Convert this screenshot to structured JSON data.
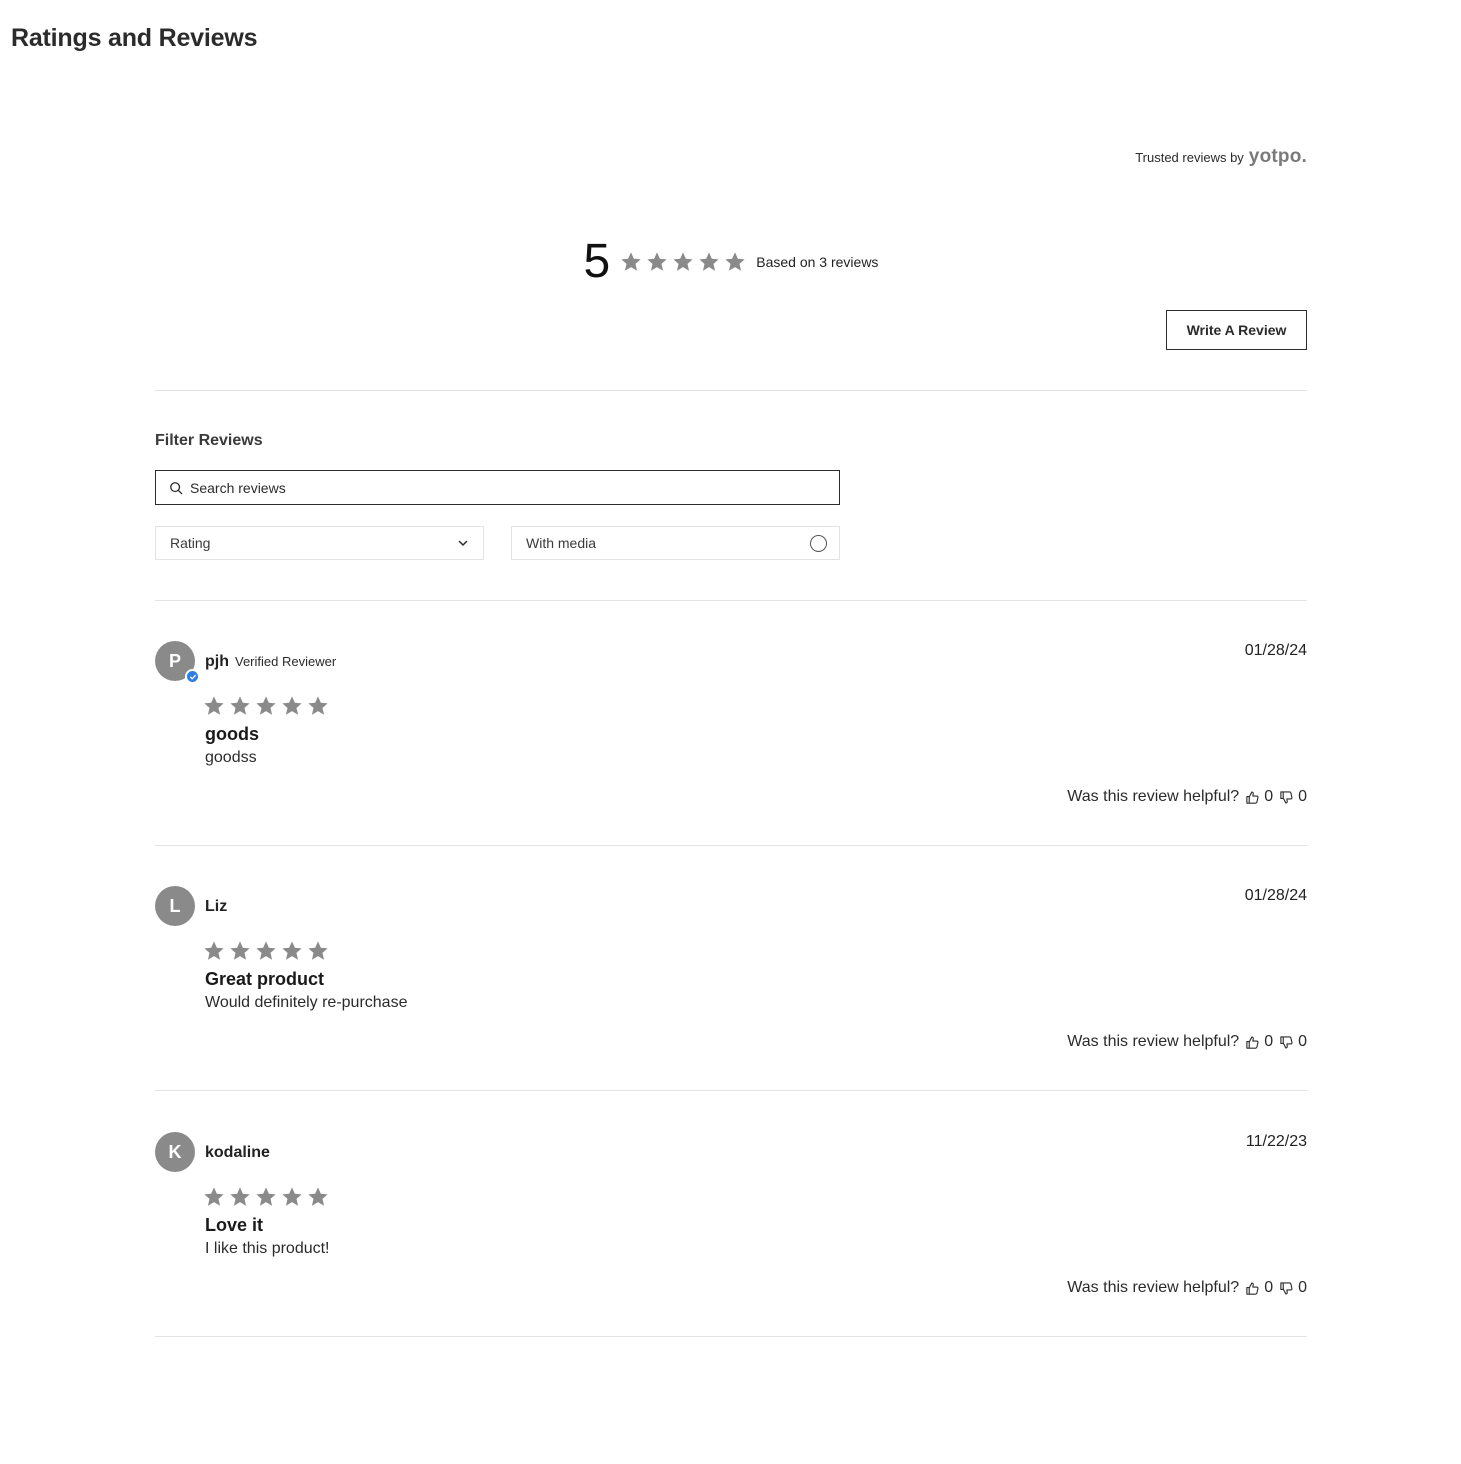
{
  "page": {
    "title": "Ratings and Reviews"
  },
  "branding": {
    "trusted_text": "Trusted reviews by",
    "logo_text": "yotpo."
  },
  "summary": {
    "average": "5",
    "stars": 5,
    "based_on": "Based on 3 reviews",
    "star_color": "#8a8a8a"
  },
  "actions": {
    "write_review": "Write A Review"
  },
  "filters": {
    "title": "Filter Reviews",
    "search_placeholder": "Search reviews",
    "rating_label": "Rating",
    "media_label": "With media"
  },
  "reviews": [
    {
      "initial": "P",
      "name": "pjh",
      "verified": true,
      "verified_label": "Verified Reviewer",
      "date": "01/28/24",
      "rating": 5,
      "title": "goods",
      "body": "goodss",
      "helpful_prompt": "Was this review helpful?",
      "up_votes": "0",
      "down_votes": "0"
    },
    {
      "initial": "L",
      "name": "Liz",
      "verified": false,
      "verified_label": "",
      "date": "01/28/24",
      "rating": 5,
      "title": "Great product",
      "body": "Would definitely re-purchase",
      "helpful_prompt": "Was this review helpful?",
      "up_votes": "0",
      "down_votes": "0"
    },
    {
      "initial": "K",
      "name": "kodaline",
      "verified": false,
      "verified_label": "",
      "date": "11/22/23",
      "rating": 5,
      "title": "Love it",
      "body": "I like this product!",
      "helpful_prompt": "Was this review helpful?",
      "up_votes": "0",
      "down_votes": "0"
    }
  ]
}
